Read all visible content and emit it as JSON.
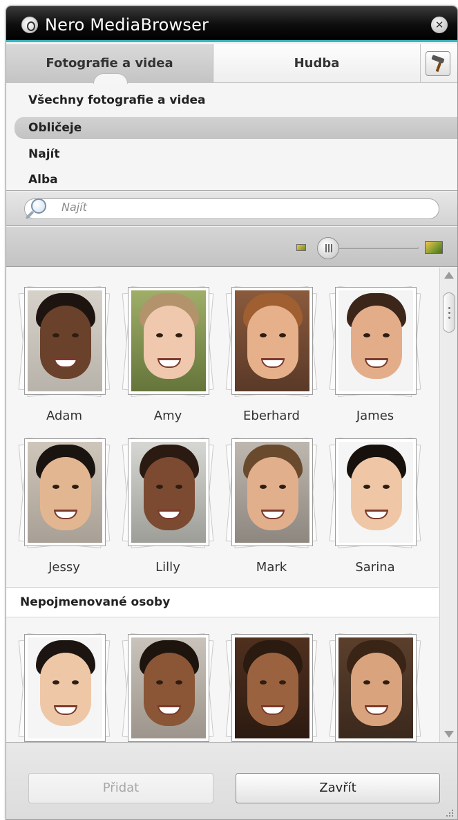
{
  "window": {
    "title": "Nero MediaBrowser",
    "close_icon": "close-icon"
  },
  "tabs": [
    {
      "label": "Fotografie a videa",
      "active": true
    },
    {
      "label": "Hudba",
      "active": false
    }
  ],
  "toolbar": {
    "tools_icon": "hammer-icon"
  },
  "categories": [
    {
      "label": "Všechny fotografie a videa",
      "selected": false
    },
    {
      "label": "Obličeje",
      "selected": true
    },
    {
      "label": "Najít",
      "selected": false
    },
    {
      "label": "Alba",
      "selected": false
    }
  ],
  "search": {
    "placeholder": "Najít"
  },
  "zoom": {
    "small_icon": "small-image-icon",
    "large_icon": "large-image-icon",
    "level": 0.1
  },
  "named_faces": [
    {
      "name": "Adam"
    },
    {
      "name": "Amy"
    },
    {
      "name": "Eberhard"
    },
    {
      "name": "James"
    },
    {
      "name": "Jessy"
    },
    {
      "name": "Lilly"
    },
    {
      "name": "Mark"
    },
    {
      "name": "Sarina"
    }
  ],
  "unnamed_section": {
    "title": "Nepojmenované osoby"
  },
  "footer": {
    "add_label": "Přidat",
    "close_label": "Zavřít"
  },
  "colors": {
    "accent": "#36b6c2",
    "titlebar": "#000000"
  }
}
